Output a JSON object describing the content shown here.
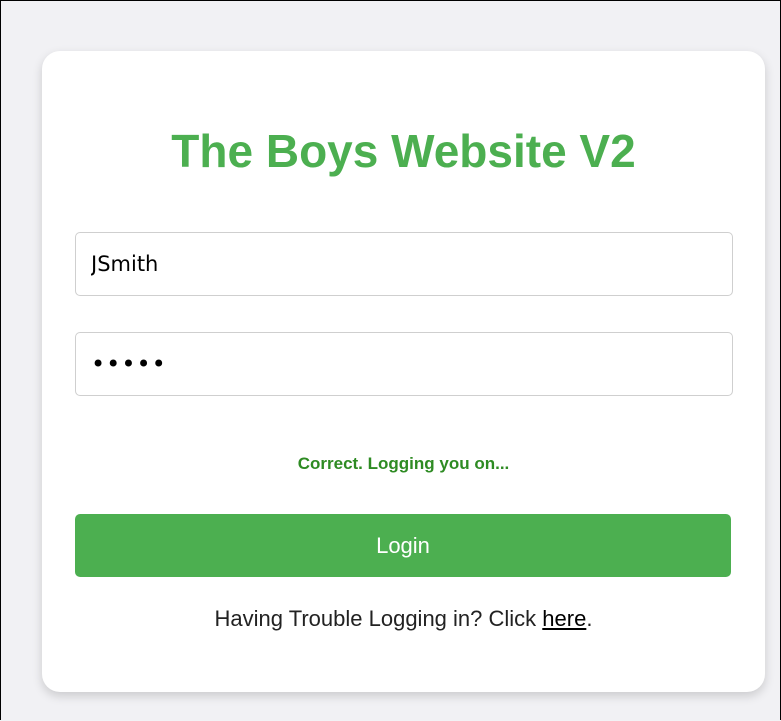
{
  "login_form": {
    "title": "The Boys Website V2",
    "username_value": "JSmith",
    "password_value": "•••••",
    "status_message": "Correct. Logging you on...",
    "login_label": "Login",
    "help_text": "Having Trouble Logging in? Click ",
    "help_link": "here",
    "help_suffix": "."
  },
  "colors": {
    "accent": "#4caf50",
    "status": "#2e8b23"
  }
}
